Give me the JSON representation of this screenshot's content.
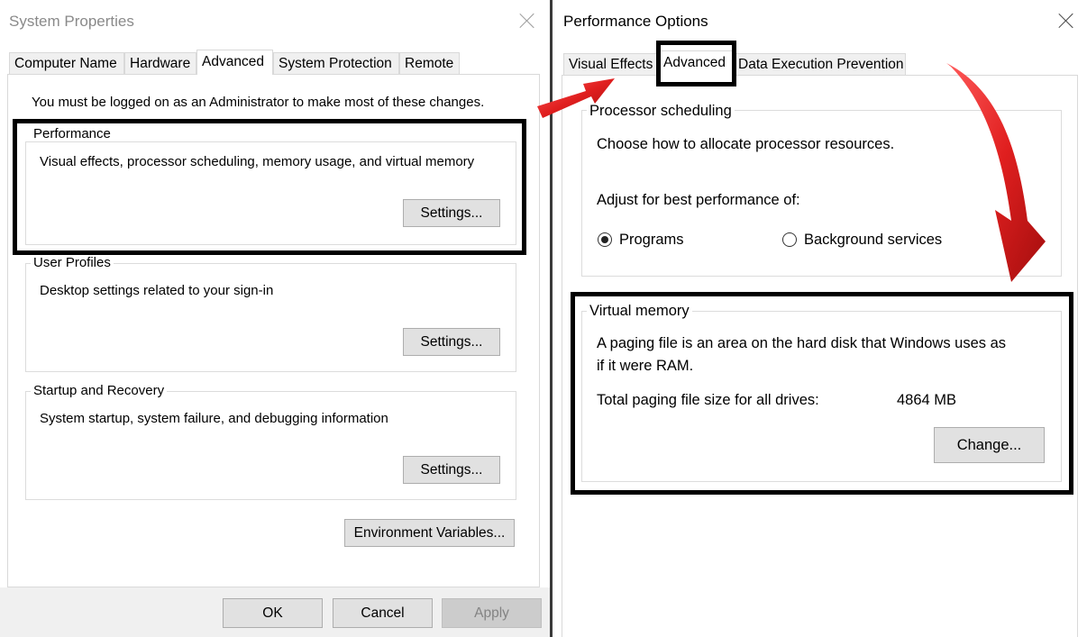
{
  "sys_props": {
    "title": "System Properties",
    "tabs": [
      "Computer Name",
      "Hardware",
      "Advanced",
      "System Protection",
      "Remote"
    ],
    "admin_note": "You must be logged on as an Administrator to make most of these changes.",
    "performance": {
      "legend": "Performance",
      "desc": "Visual effects, processor scheduling, memory usage, and virtual memory",
      "button": "Settings..."
    },
    "user_profiles": {
      "legend": "User Profiles",
      "desc": "Desktop settings related to your sign-in",
      "button": "Settings..."
    },
    "startup_recovery": {
      "legend": "Startup and Recovery",
      "desc": "System startup, system failure, and debugging information",
      "button": "Settings..."
    },
    "env_button": "Environment Variables...",
    "footer": {
      "ok": "OK",
      "cancel": "Cancel",
      "apply": "Apply"
    }
  },
  "perf_opts": {
    "title": "Performance Options",
    "tabs": [
      "Visual Effects",
      "Advanced",
      "Data Execution Prevention"
    ],
    "processor": {
      "legend": "Processor scheduling",
      "desc": "Choose how to allocate processor resources.",
      "adjust_label": "Adjust for best performance of:",
      "options": [
        "Programs",
        "Background services"
      ],
      "selected": "Programs"
    },
    "virtual_memory": {
      "legend": "Virtual memory",
      "desc_line1": "A paging file is an area on the hard disk that Windows uses as",
      "desc_line2": "if it were RAM.",
      "total_label": "Total paging file size for all drives:",
      "total_value": "4864 MB",
      "button": "Change..."
    }
  },
  "colors": {
    "annotation_arrow": "#e01f1f",
    "highlight_border": "#000000"
  }
}
